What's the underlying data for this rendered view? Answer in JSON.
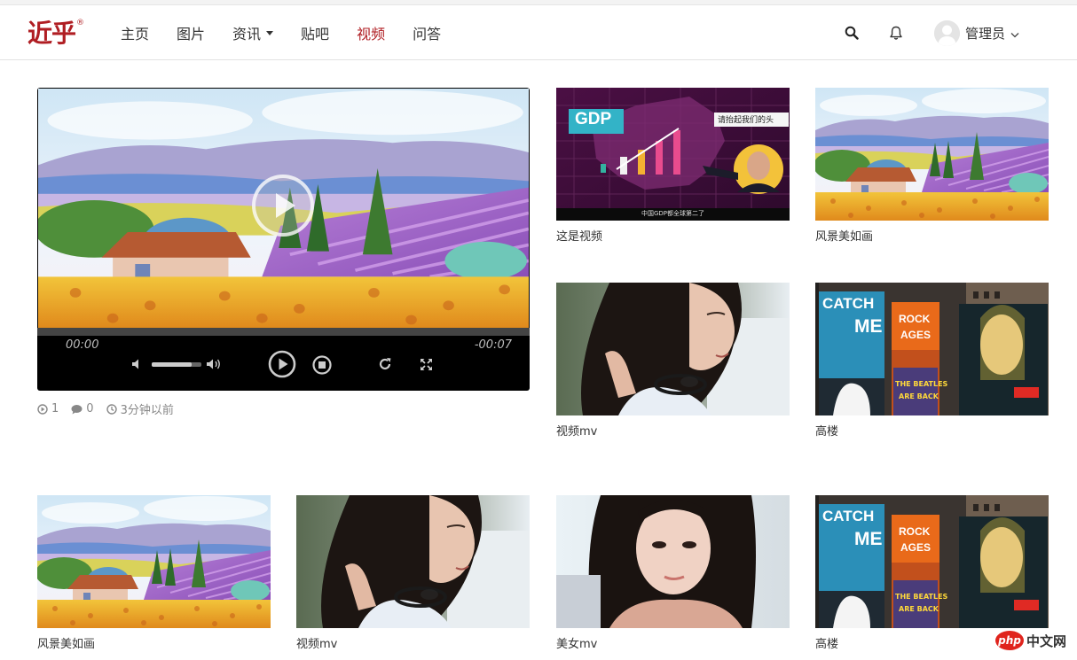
{
  "nav": {
    "logo": "近乎",
    "logo_mark": "®",
    "items": [
      {
        "label": "主页"
      },
      {
        "label": "图片"
      },
      {
        "label": "资讯"
      },
      {
        "label": "贴吧"
      },
      {
        "label": "视频"
      },
      {
        "label": "问答"
      }
    ],
    "active_item": "视频",
    "user_name": "管理员",
    "icons": [
      "search-icon",
      "bell-icon",
      "avatar",
      "chevron-down-icon"
    ]
  },
  "player": {
    "time_current": "00:00",
    "time_remaining": "-00:07",
    "progress": 0,
    "volume": 0.8,
    "stats": {
      "plays": "1",
      "comments": "0",
      "posted": "3分钟以前"
    },
    "controls": [
      "mute-icon",
      "volume-up-icon",
      "play-icon",
      "stop-icon",
      "reload-icon",
      "fullscreen-icon"
    ]
  },
  "thumbnails": {
    "t1": {
      "caption": "这是视频",
      "overlay_badge": "GDP",
      "overlay_bubble": "请抬起我们的头",
      "overlay_subtitle": "中国GDP都全球第二了"
    },
    "t2": {
      "caption": "风景美如画"
    },
    "t3": {
      "caption": "视频mv"
    },
    "t4": {
      "caption": "高楼",
      "sign_1a": "CATCH",
      "sign_1b": "ME",
      "sign_2a": "ROCK",
      "sign_2b": "AGES",
      "sign_3a": "THE BEATLES",
      "sign_3b": "ARE BACK"
    },
    "t5": {
      "caption": "风景美如画"
    },
    "t6": {
      "caption": "视频mv"
    },
    "t7": {
      "caption": "美女mv"
    },
    "t8": {
      "caption": "高楼",
      "sign_1a": "CATCH",
      "sign_1b": "ME",
      "sign_2a": "ROCK",
      "sign_2b": "AGES",
      "sign_3a": "THE BEATLES",
      "sign_3b": "ARE BACK"
    }
  },
  "watermark": {
    "badge": "php",
    "text": "中文网"
  }
}
